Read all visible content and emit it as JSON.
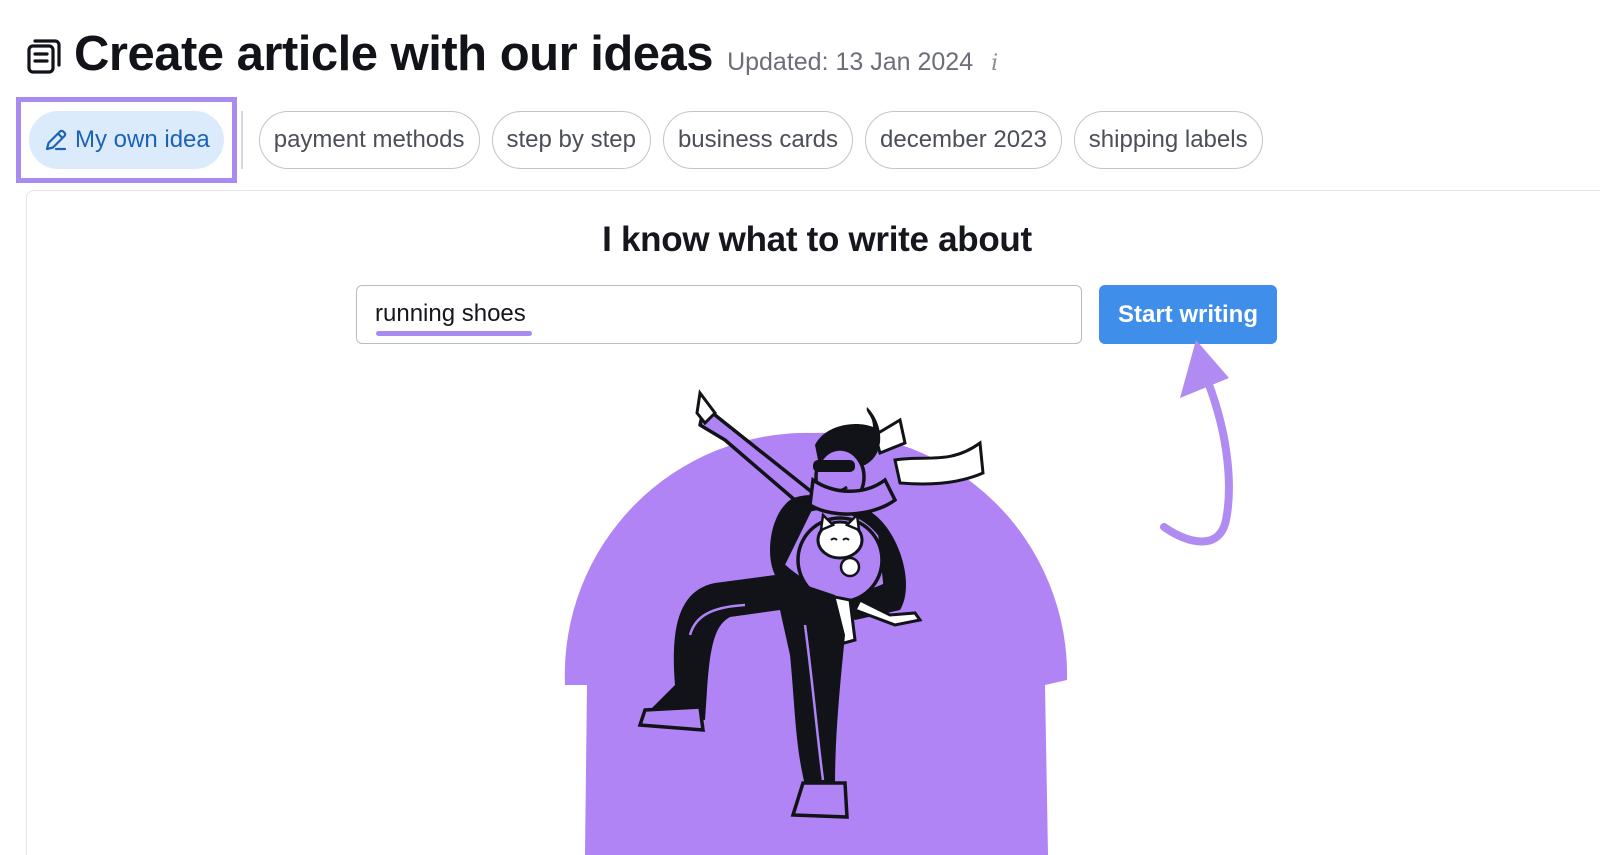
{
  "header": {
    "title": "Create article with our ideas",
    "updated": "Updated: 13 Jan 2024",
    "info_glyph": "i",
    "icon": "document-icon"
  },
  "chips": {
    "active": {
      "label": "My own idea",
      "icon": "pencil-icon"
    },
    "suggestions": [
      {
        "label": "payment methods"
      },
      {
        "label": "step by step"
      },
      {
        "label": "business cards"
      },
      {
        "label": "december 2023"
      },
      {
        "label": "shipping labels"
      }
    ]
  },
  "main": {
    "heading": "I know what to write about",
    "topic_input": {
      "value": "running shoes"
    },
    "start_button": "Start writing"
  },
  "colors": {
    "accent_purple": "#a88bf0",
    "button_blue": "#3f8ee9",
    "active_chip_bg": "#dcebfb",
    "illustration_purple": "#b084f5"
  }
}
